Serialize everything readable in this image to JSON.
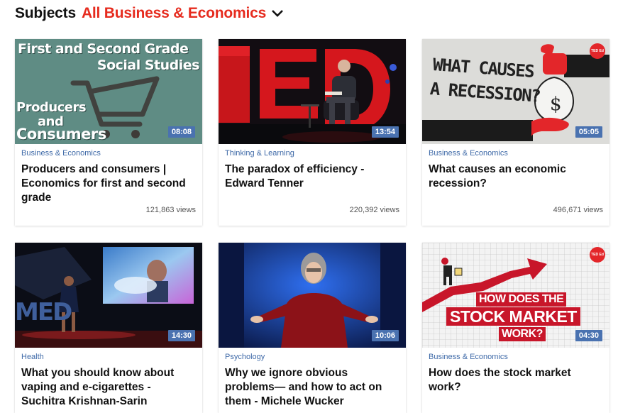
{
  "header": {
    "label": "Subjects",
    "subject_value": "All Business & Economics"
  },
  "cards": [
    {
      "thumb_text": [
        "First and Second Grade",
        "Social Studies",
        "Producers",
        "and",
        "Consumers"
      ],
      "duration": "08:08",
      "topic": "Business & Economics",
      "title": "Producers and consumers | Economics for first and second grade",
      "views": "121,863 views"
    },
    {
      "thumb_text": [],
      "duration": "13:54",
      "topic": "Thinking & Learning",
      "title": "The paradox of efficiency - Edward Tenner",
      "views": "220,392 views"
    },
    {
      "thumb_text": [
        "WHAT CAUSES",
        "A RECESSION?",
        "TED Ed"
      ],
      "duration": "05:05",
      "topic": "Business & Economics",
      "title": "What causes an economic recession?",
      "views": "496,671 views"
    },
    {
      "thumb_text": [
        "MED"
      ],
      "duration": "14:30",
      "topic": "Health",
      "title": "What you should know about vaping and e-cigarettes - Suchitra Krishnan-Sarin",
      "views": ""
    },
    {
      "thumb_text": [],
      "duration": "10:06",
      "topic": "Psychology",
      "title": "Why we ignore obvious problems— and how to act on them - Michele Wucker",
      "views": ""
    },
    {
      "thumb_text": [
        "HOW DOES THE",
        "STOCK MARKET",
        "WORK?",
        "TED Ed"
      ],
      "duration": "04:30",
      "topic": "Business & Economics",
      "title": "How does the stock market work?",
      "views": ""
    }
  ],
  "colors": {
    "accent_red": "#e62b1e",
    "topic_blue": "#3f6aa8",
    "duration_bg": "#4a72b0"
  }
}
